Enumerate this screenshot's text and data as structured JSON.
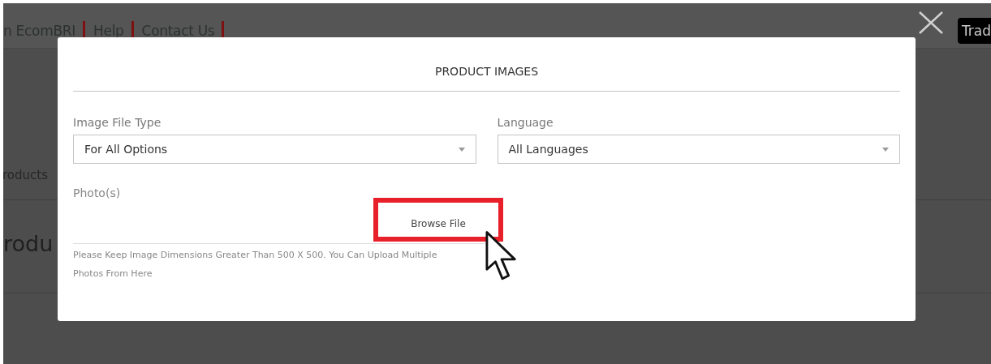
{
  "background_page": {
    "nav_links": [
      "n EcomBRI",
      "Help",
      "Contact Us"
    ],
    "badge": "Trad",
    "tab": "roducts",
    "heading": "rodu"
  },
  "modal": {
    "title": "PRODUCT IMAGES",
    "fields": [
      {
        "label": "Image File Type",
        "value": "For All Options"
      },
      {
        "label": "Language",
        "value": "All Languages"
      }
    ],
    "photos": {
      "label": "Photo(s)",
      "button": "Browse File",
      "highlighted": true,
      "hint": "Please Keep Image Dimensions Greater Than 500 X 500. You Can Upload Multiple Photos From Here"
    }
  }
}
